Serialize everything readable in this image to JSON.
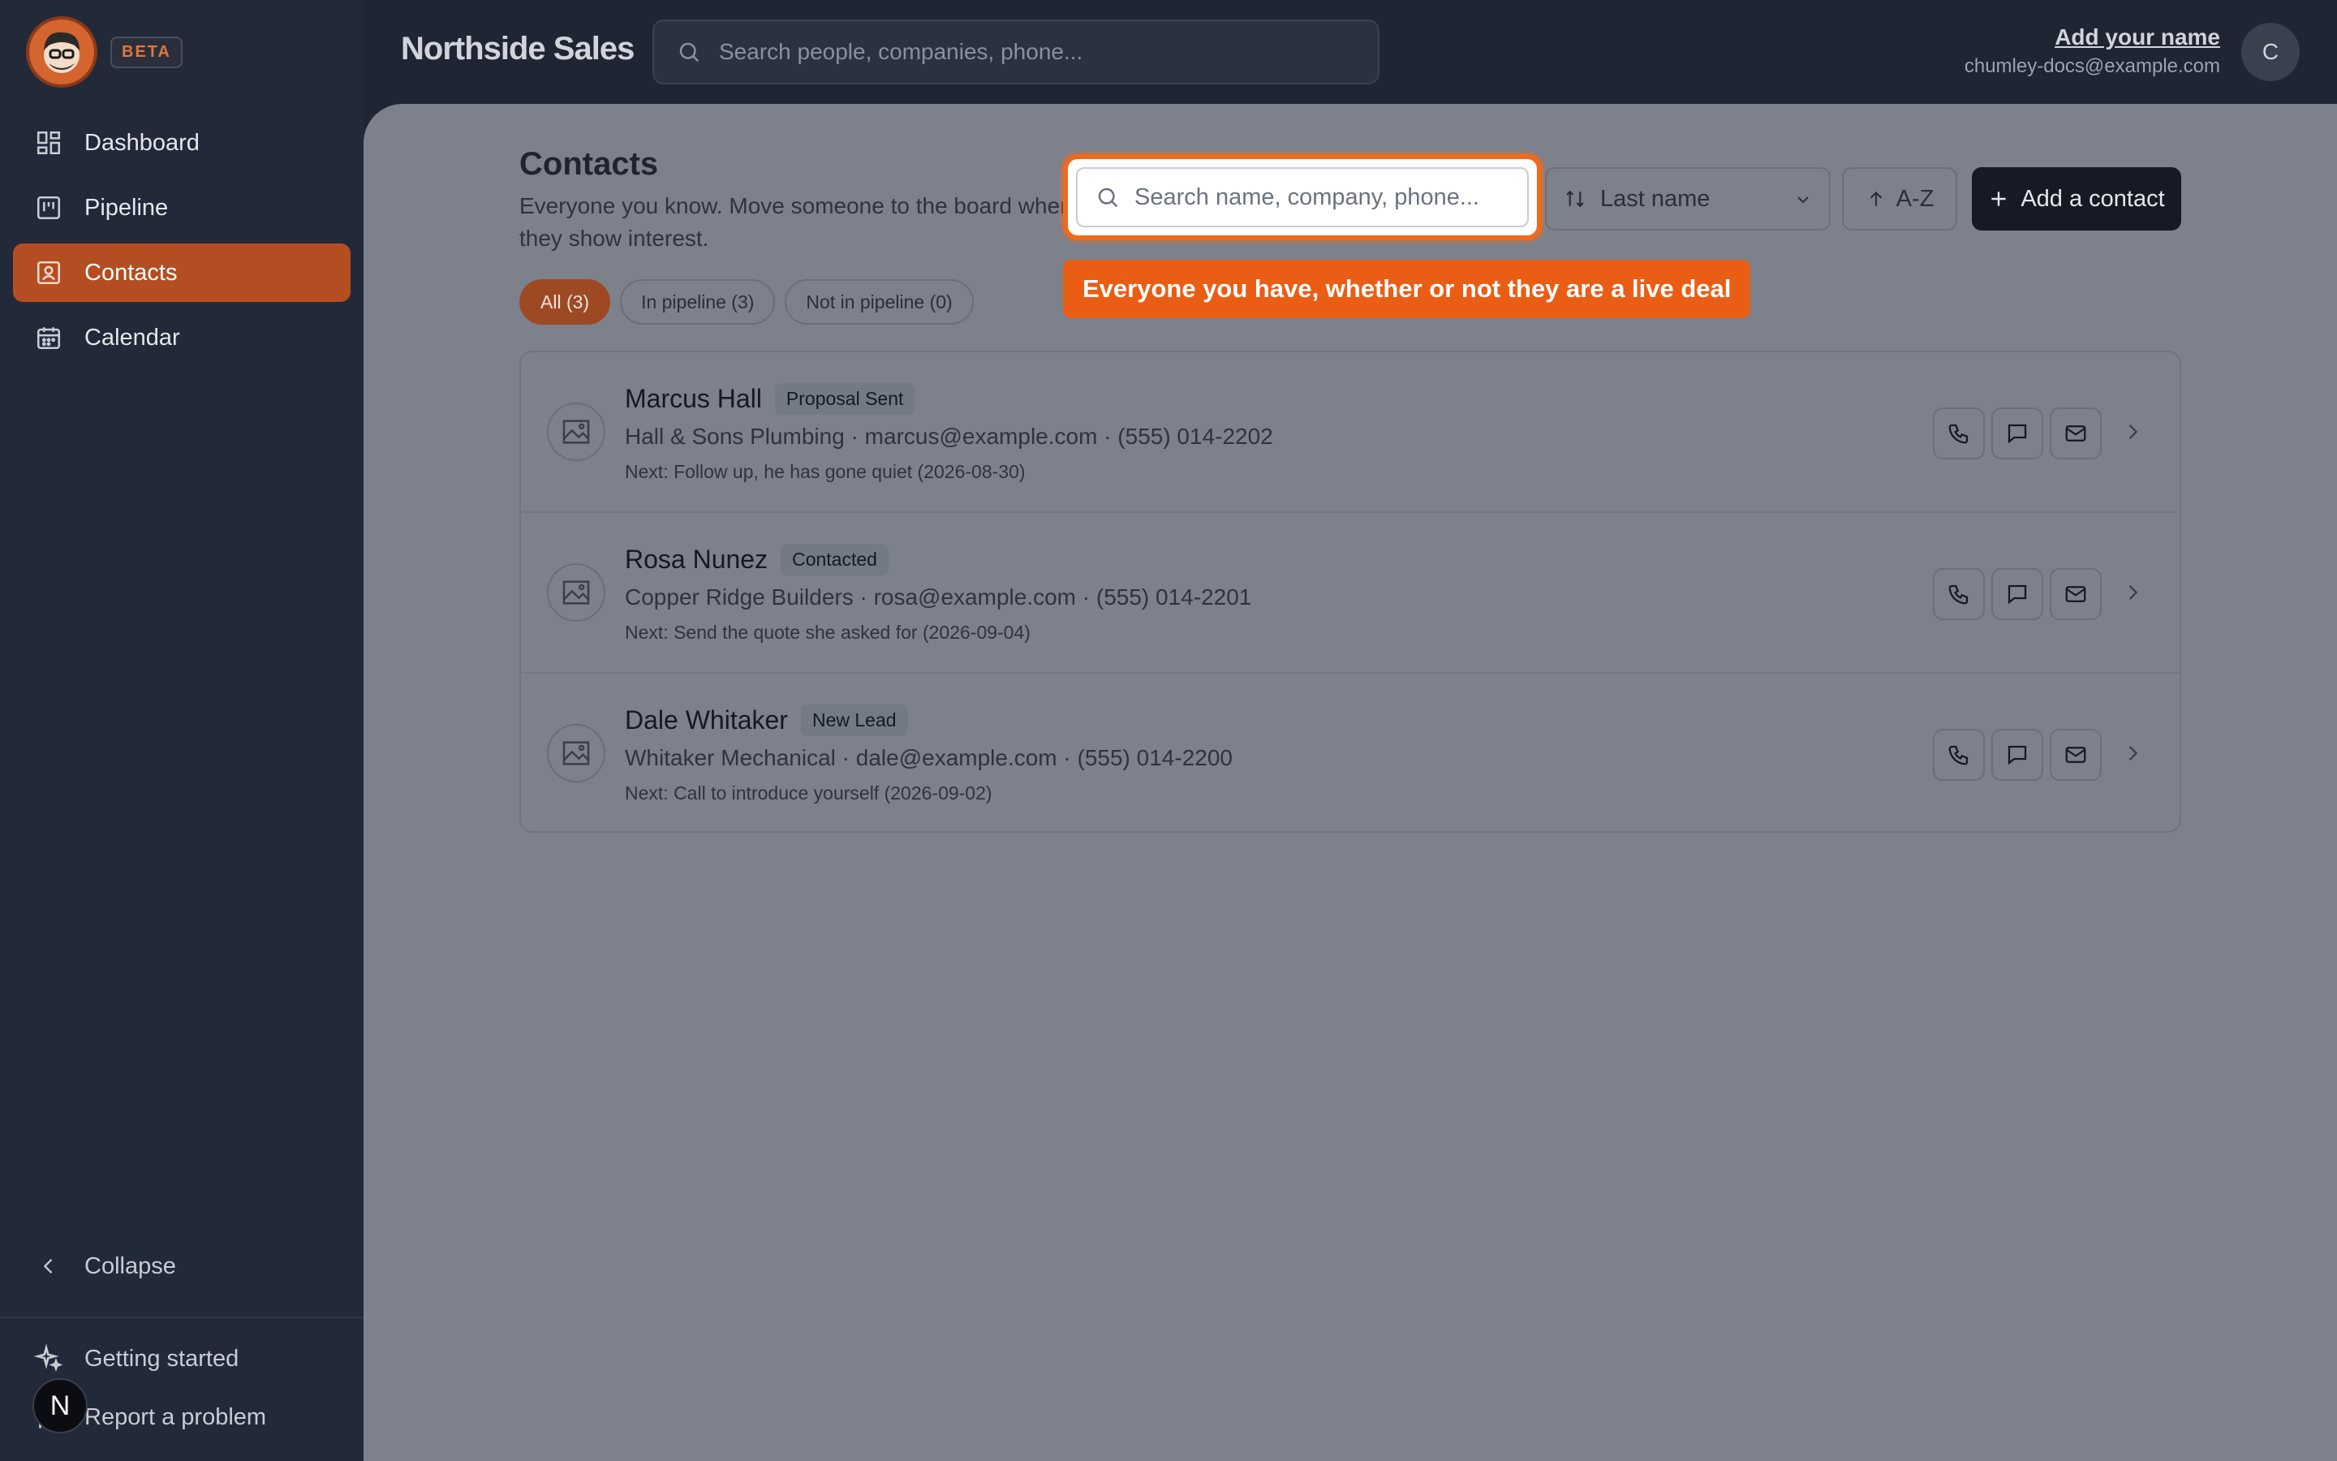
{
  "app": {
    "badge": "BETA",
    "title": "Northside Sales"
  },
  "top_search": {
    "placeholder": "Search people, companies, phone..."
  },
  "user": {
    "name": "Add your name",
    "email": "chumley-docs@example.com",
    "initial": "C"
  },
  "sidebar": {
    "items": [
      {
        "label": "Dashboard",
        "icon": "dashboard-icon"
      },
      {
        "label": "Pipeline",
        "icon": "kanban-icon"
      },
      {
        "label": "Contacts",
        "icon": "contact-card-icon",
        "active": true
      },
      {
        "label": "Calendar",
        "icon": "calendar-icon"
      }
    ],
    "collapse": "Collapse",
    "getting_started": "Getting started",
    "report": "Report a problem",
    "help_badge": "N"
  },
  "page": {
    "title": "Contacts",
    "description": "Everyone you know. Move someone to the board when they show interest.",
    "sort_field": "Last name",
    "sort_dir": "A-Z",
    "add_button": "Add a contact",
    "filters": [
      {
        "label": "All (3)",
        "active": true
      },
      {
        "label": "In pipeline (3)"
      },
      {
        "label": "Not in pipeline (0)"
      }
    ],
    "search_placeholder": "Search name, company, phone...",
    "tooltip": "Everyone you have, whether or not they are a live deal"
  },
  "contacts": [
    {
      "name": "Marcus Hall",
      "status": "Proposal Sent",
      "details": "Hall & Sons Plumbing · marcus@example.com · (555) 014-2202",
      "next": "Next: Follow up, he has gone quiet (2026-08-30)"
    },
    {
      "name": "Rosa Nunez",
      "status": "Contacted",
      "details": "Copper Ridge Builders · rosa@example.com · (555) 014-2201",
      "next": "Next: Send the quote she asked for (2026-09-04)"
    },
    {
      "name": "Dale Whitaker",
      "status": "New Lead",
      "details": "Whitaker Mechanical · dale@example.com · (555) 014-2200",
      "next": "Next: Call to introduce yourself (2026-09-02)"
    }
  ],
  "colors": {
    "accent": "#b44e22",
    "highlight": "#f06a1d",
    "sidebar_bg": "#222939",
    "overlay_main": "#7c818c"
  }
}
